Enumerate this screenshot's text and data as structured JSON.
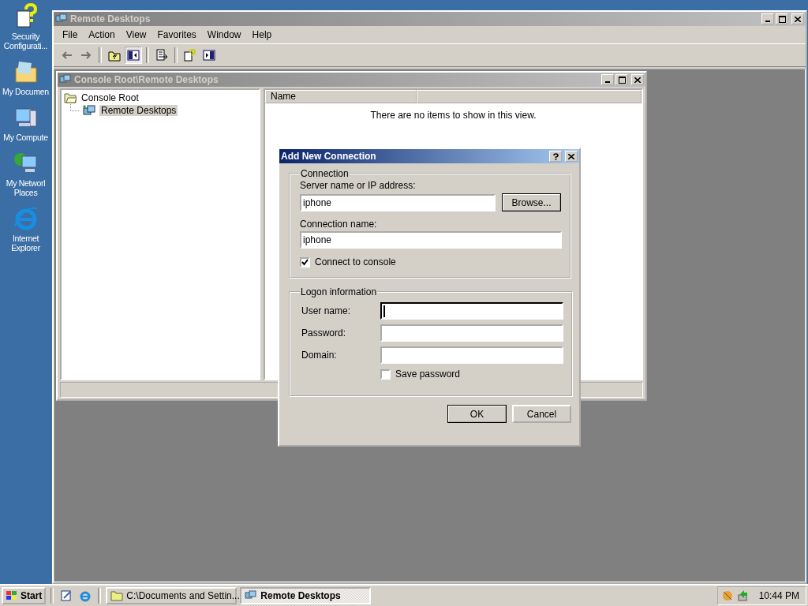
{
  "desktop_icons": [
    {
      "kind": "security",
      "label": "Security Configurati..."
    },
    {
      "kind": "documents",
      "label": "My Documen"
    },
    {
      "kind": "computer",
      "label": "My Compute"
    },
    {
      "kind": "network",
      "label": "My Networl Places"
    },
    {
      "kind": "browser",
      "label": "Internet Explorer"
    }
  ],
  "main_window": {
    "title": "Remote Desktops",
    "active": false,
    "menu": [
      "File",
      "Action",
      "View",
      "Favorites",
      "Window",
      "Help"
    ],
    "toolbar": [
      {
        "kind": "back",
        "disabled": true,
        "pressed": false
      },
      {
        "kind": "forward",
        "disabled": true,
        "pressed": false
      },
      {
        "kind": "separator"
      },
      {
        "kind": "up",
        "disabled": false,
        "pressed": false
      },
      {
        "kind": "tree",
        "disabled": false,
        "pressed": true
      },
      {
        "kind": "separator"
      },
      {
        "kind": "export",
        "disabled": false,
        "pressed": false
      },
      {
        "kind": "separator"
      },
      {
        "kind": "help",
        "disabled": false,
        "pressed": false
      },
      {
        "kind": "pane",
        "disabled": false,
        "pressed": false
      }
    ]
  },
  "console_window": {
    "title": "Console Root\\Remote Desktops",
    "active": false,
    "tree": [
      {
        "label": "Console Root",
        "expanded": true,
        "children": [
          {
            "label": "Remote Desktops",
            "selected": true
          }
        ]
      }
    ],
    "columns": [
      "Name"
    ],
    "empty_message": "There are no items to show in this view."
  },
  "dialog": {
    "title": "Add New Connection",
    "active": true,
    "connection": {
      "legend": "Connection",
      "server_label": "Server name or IP address:",
      "server_value": "iphone",
      "browse": "Browse...",
      "name_label": "Connection name:",
      "name_value": "iphone",
      "console": {
        "label": "Connect to console",
        "checked": true
      }
    },
    "logon": {
      "legend": "Logon information",
      "fields": [
        {
          "label": "User name:",
          "focused": true
        },
        {
          "label": "Password:",
          "focused": false
        },
        {
          "label": "Domain:",
          "focused": false
        }
      ],
      "save_password": {
        "label": "Save password",
        "checked": false
      }
    },
    "buttons": [
      {
        "label": "OK",
        "default": true
      },
      {
        "label": "Cancel",
        "default": false
      }
    ]
  },
  "taskbar": {
    "start": "Start",
    "quick_launch": [
      {
        "kind": "page"
      },
      {
        "kind": "browser"
      }
    ],
    "tasks": [
      {
        "label": "C:\\Documents and Settin...",
        "selected": false,
        "kind": "folder"
      },
      {
        "label": "Remote Desktops",
        "selected": true,
        "kind": "console"
      }
    ],
    "clock": "10:44 PM"
  }
}
